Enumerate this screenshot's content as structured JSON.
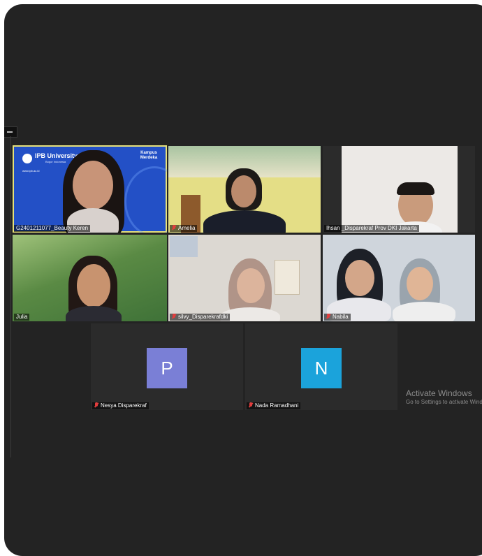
{
  "participants": [
    {
      "id": "p1",
      "name": "G2401211077_Beauty Keren",
      "muted": false,
      "speaking": true,
      "background": {
        "university": "IPB University",
        "campus": "Bogor Indonesia",
        "site": "www.ipb.ac.id",
        "program": "Kampus Merdeka"
      }
    },
    {
      "id": "p2",
      "name": "Amelia",
      "muted": true
    },
    {
      "id": "p3",
      "name": "Ihsan _Disparekraf Prov DKI Jakarta",
      "muted": false
    },
    {
      "id": "p4",
      "name": "Julia",
      "muted": false
    },
    {
      "id": "p5",
      "name": "silvy_Disparekrafdki",
      "muted": true
    },
    {
      "id": "p6",
      "name": "Nabila",
      "muted": true
    },
    {
      "id": "p7",
      "name": "Nesya Disparekraf",
      "muted": true,
      "initial": "P",
      "avatar_color": "#7a7fd6"
    },
    {
      "id": "p8",
      "name": "Nada Ramadhani",
      "muted": true,
      "initial": "N",
      "avatar_color": "#1ba3db"
    }
  ],
  "watermark": {
    "title": "Activate Windows",
    "subtitle": "Go to Settings to activate Windows."
  },
  "colors": {
    "frame": "#232323",
    "tile": "#2b2b2b",
    "speaker_outline": "#e7e17a",
    "muted_mic": "#e23d3d"
  }
}
